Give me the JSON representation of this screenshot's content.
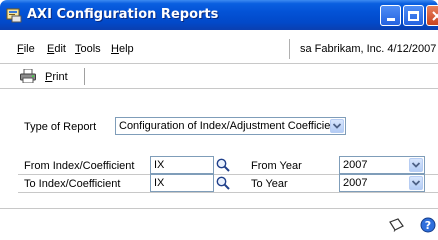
{
  "window": {
    "title": "AXI Configuration Reports",
    "colors": {
      "titlebar": "#0352d6",
      "close_button": "#c84320"
    }
  },
  "menu": {
    "file": {
      "key": "F",
      "rest": "ile"
    },
    "edit": {
      "key": "E",
      "rest": "dit"
    },
    "tools": {
      "key": "T",
      "rest": "ools"
    },
    "help": {
      "key": "H",
      "rest": "elp"
    }
  },
  "status": "sa  Fabrikam, Inc.  4/12/2007",
  "toolbar": {
    "print": {
      "key": "P",
      "rest": "rint"
    }
  },
  "form": {
    "type_of_report": {
      "label": "Type of Report",
      "value": "Configuration of Index/Adjustment Coefficient"
    },
    "from_index": {
      "label": "From Index/Coefficient",
      "value": "IX"
    },
    "to_index": {
      "label": "To Index/Coefficient",
      "value": "IX"
    },
    "from_year": {
      "label": "From Year",
      "value": "2007"
    },
    "to_year": {
      "label": "To Year",
      "value": "2007"
    }
  },
  "icons": {
    "app": "report-window-icon",
    "print": "printer-icon",
    "lookup": "magnifier-icon",
    "dropdown": "chevron-down-icon",
    "note": "note-icon",
    "help": "help-icon"
  }
}
